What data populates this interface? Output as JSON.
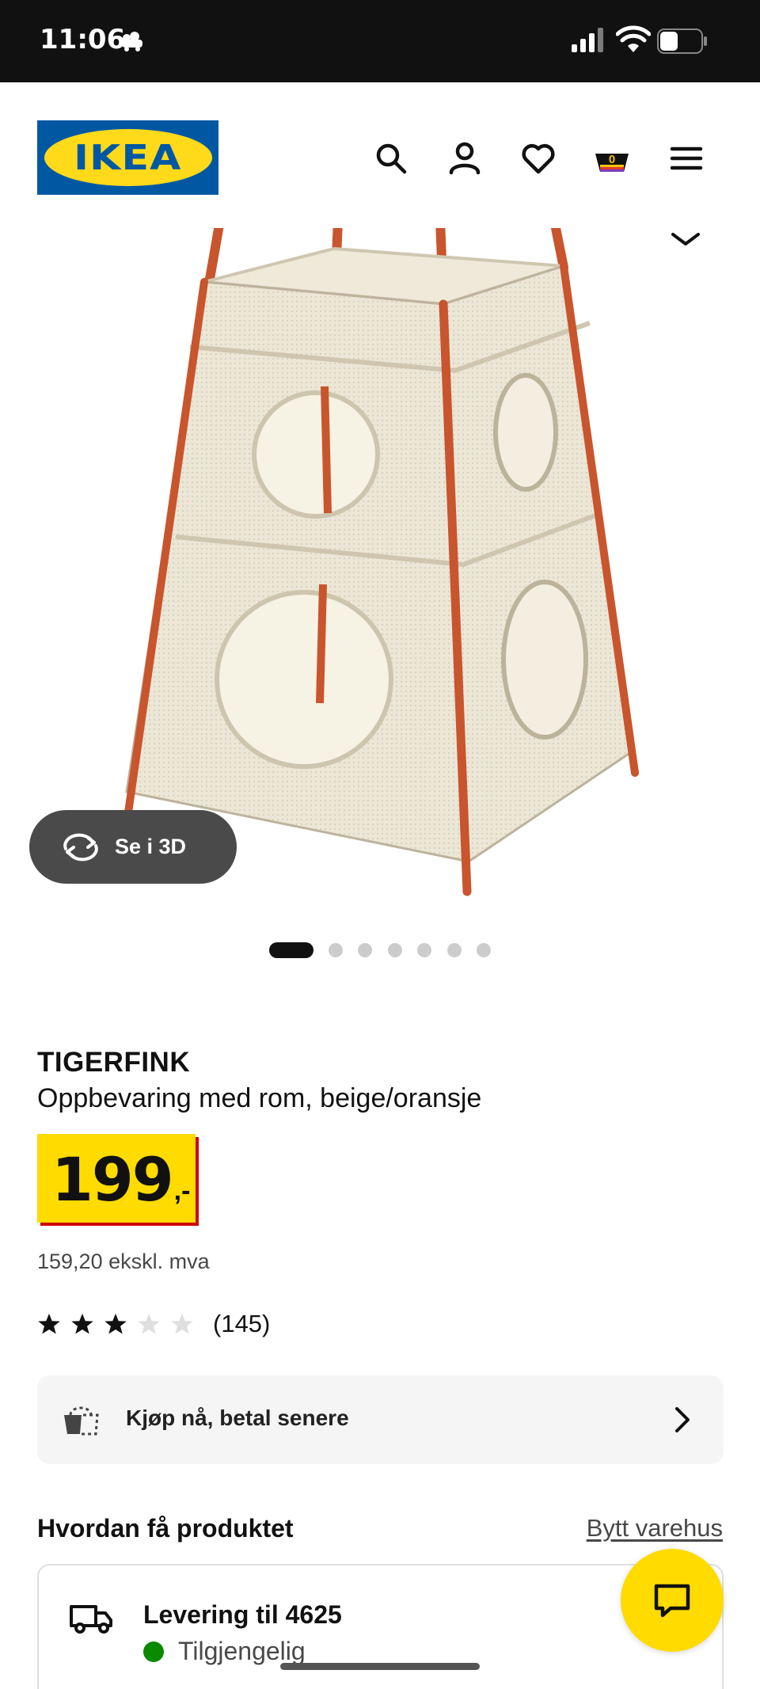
{
  "status_bar": {
    "time": "11:06",
    "icons": [
      "activity-icon",
      "cellular-signal-icon",
      "wifi-icon",
      "battery-icon"
    ]
  },
  "header": {
    "logo_text": "IKEA",
    "icons": [
      "search-icon",
      "user-icon",
      "heart-icon",
      "cart-icon",
      "menu-icon"
    ],
    "cart_count": "0"
  },
  "gallery": {
    "view_3d_label": "Se i 3D",
    "slide_count": 7,
    "active_slide": 1
  },
  "product": {
    "name": "TIGERFINK",
    "description": "Oppbevaring med rom, beige/oransje",
    "price_integer": "199",
    "price_decimals": ",-",
    "price_ex_vat": "159,20 ekskl. mva",
    "rating": 3,
    "rating_max": 5,
    "review_count": "(145)"
  },
  "payment": {
    "label": "Kjøp nå, betal senere"
  },
  "fulfilment": {
    "title": "Hvordan få produktet",
    "change_store_label": "Bytt varehus",
    "delivery_title": "Levering til 4625",
    "availability": "Tilgjengelig"
  },
  "colors": {
    "ikea_blue": "#0058a3",
    "ikea_yellow": "#ffdb00",
    "price_shadow": "#cc0008",
    "available_green": "#0a8a00"
  }
}
